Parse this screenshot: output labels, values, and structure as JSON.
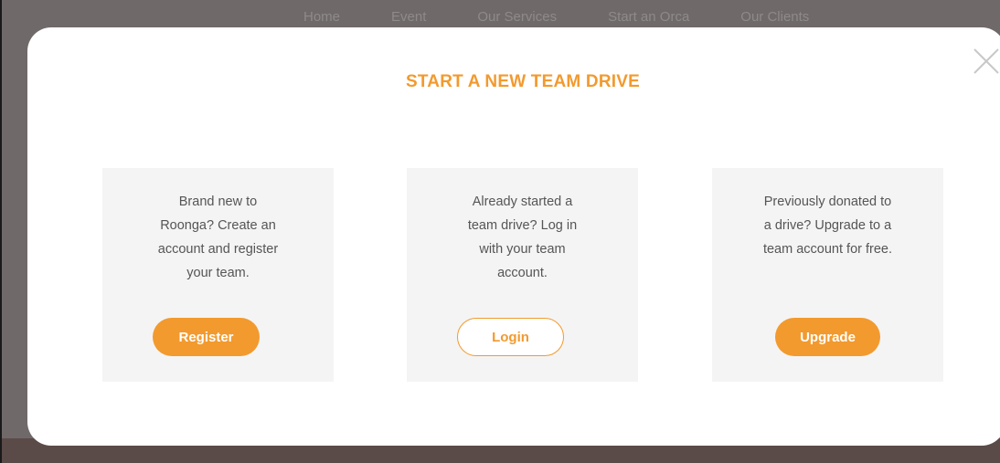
{
  "background_nav": {
    "items": [
      "Home",
      "Event",
      "Our Services",
      "Start an Orca",
      "Our Clients"
    ]
  },
  "modal": {
    "title": "START A NEW TEAM DRIVE",
    "close_icon": "close-icon"
  },
  "cards": [
    {
      "lines": [
        "Brand new to",
        "Roonga? Create an",
        "account and register",
        "your team."
      ],
      "button_label": "Register",
      "button_style": "filled"
    },
    {
      "lines": [
        "Already started a",
        "team drive? Log in",
        "with your team",
        "account."
      ],
      "button_label": "Login",
      "button_style": "outline"
    },
    {
      "lines": [
        "Previously donated to",
        "a drive? Upgrade to a",
        "team account for free."
      ],
      "button_label": "Upgrade",
      "button_style": "filled"
    }
  ],
  "colors": {
    "accent": "#f29a2e",
    "card_bg": "#f4f4f4",
    "text": "#555555",
    "backdrop": "#6f6a69"
  }
}
